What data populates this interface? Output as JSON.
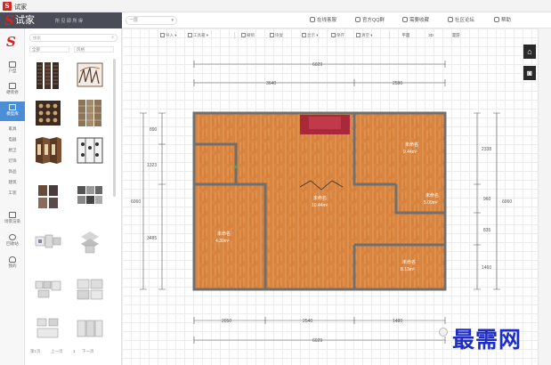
{
  "window": {
    "title": "试家"
  },
  "header": {
    "brand_name": "试家",
    "brand_slogan": "所见即所得",
    "plan_select": "一层",
    "links": [
      {
        "label": "在线客服"
      },
      {
        "label": "官方QQ群"
      },
      {
        "label": "需要收藏"
      },
      {
        "label": "社区论坛"
      },
      {
        "label": "帮助"
      }
    ]
  },
  "sidebar": {
    "items": [
      {
        "label": "户型"
      },
      {
        "label": "硬装修"
      },
      {
        "label": "模型库"
      },
      {
        "label": "场景渲染"
      },
      {
        "label": "回收站"
      },
      {
        "label": "我的"
      }
    ],
    "categories": [
      "家具",
      "电器",
      "厨卫",
      "灯饰",
      "饰品",
      "建筑",
      "工装"
    ],
    "active_index": 2
  },
  "catalog": {
    "search_placeholder": "搜索",
    "filters": [
      "全部",
      "风格"
    ],
    "footer": {
      "first": "第1页",
      "prev": "上一页",
      "next": "下一页",
      "page": "1"
    }
  },
  "toolbar": {
    "items": [
      {
        "label": "导入"
      },
      {
        "label": "工具箱"
      },
      {
        "label": "撤销"
      },
      {
        "label": "恢复"
      },
      {
        "label": "显示"
      },
      {
        "label": "保存"
      },
      {
        "label": "清空"
      }
    ],
    "view_modes": [
      "平面",
      "3D",
      "漫游"
    ]
  },
  "floorplan": {
    "dimensions": {
      "top_total": "6029",
      "top_left": "3640",
      "top_right": "2580",
      "left_total": "6060",
      "left_segments": [
        "890",
        "1323",
        "3485"
      ],
      "right_total": "6060",
      "right_segments": [
        "2338",
        "960",
        "835",
        "1460"
      ],
      "bottom_total": "6029",
      "bottom_segments": [
        "2050",
        "2540",
        "1480"
      ]
    },
    "rooms": [
      {
        "name": "未命名",
        "area": "9.44m²"
      },
      {
        "name": "未命名",
        "area": "5.09m²"
      },
      {
        "name": "未命名",
        "area": "10.44m²"
      },
      {
        "name": "未命名",
        "area": "4.30m²"
      },
      {
        "name": "未命名",
        "area": "8.13m²"
      }
    ],
    "colors": {
      "floor": "#d9843f",
      "wall": "#6f6f6f",
      "bed": "#a8293a"
    }
  },
  "watermark": "最需网",
  "icons": [
    "home-icon",
    "camera-icon",
    "search-icon"
  ]
}
